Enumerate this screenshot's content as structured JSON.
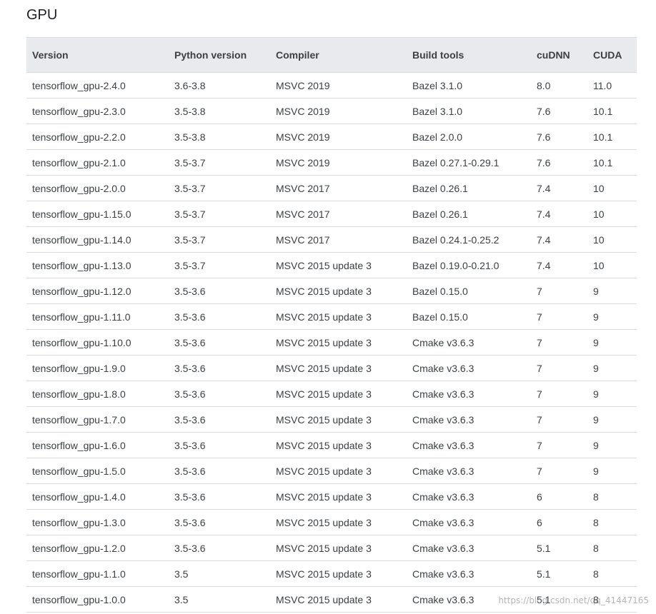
{
  "heading": "GPU",
  "table": {
    "headers": [
      "Version",
      "Python version",
      "Compiler",
      "Build tools",
      "cuDNN",
      "CUDA"
    ],
    "rows": [
      [
        "tensorflow_gpu-2.4.0",
        "3.6-3.8",
        "MSVC 2019",
        "Bazel 3.1.0",
        "8.0",
        "11.0"
      ],
      [
        "tensorflow_gpu-2.3.0",
        "3.5-3.8",
        "MSVC 2019",
        "Bazel 3.1.0",
        "7.6",
        "10.1"
      ],
      [
        "tensorflow_gpu-2.2.0",
        "3.5-3.8",
        "MSVC 2019",
        "Bazel 2.0.0",
        "7.6",
        "10.1"
      ],
      [
        "tensorflow_gpu-2.1.0",
        "3.5-3.7",
        "MSVC 2019",
        "Bazel 0.27.1-0.29.1",
        "7.6",
        "10.1"
      ],
      [
        "tensorflow_gpu-2.0.0",
        "3.5-3.7",
        "MSVC 2017",
        "Bazel 0.26.1",
        "7.4",
        "10"
      ],
      [
        "tensorflow_gpu-1.15.0",
        "3.5-3.7",
        "MSVC 2017",
        "Bazel 0.26.1",
        "7.4",
        "10"
      ],
      [
        "tensorflow_gpu-1.14.0",
        "3.5-3.7",
        "MSVC 2017",
        "Bazel 0.24.1-0.25.2",
        "7.4",
        "10"
      ],
      [
        "tensorflow_gpu-1.13.0",
        "3.5-3.7",
        "MSVC 2015 update 3",
        "Bazel 0.19.0-0.21.0",
        "7.4",
        "10"
      ],
      [
        "tensorflow_gpu-1.12.0",
        "3.5-3.6",
        "MSVC 2015 update 3",
        "Bazel 0.15.0",
        "7",
        "9"
      ],
      [
        "tensorflow_gpu-1.11.0",
        "3.5-3.6",
        "MSVC 2015 update 3",
        "Bazel 0.15.0",
        "7",
        "9"
      ],
      [
        "tensorflow_gpu-1.10.0",
        "3.5-3.6",
        "MSVC 2015 update 3",
        "Cmake v3.6.3",
        "7",
        "9"
      ],
      [
        "tensorflow_gpu-1.9.0",
        "3.5-3.6",
        "MSVC 2015 update 3",
        "Cmake v3.6.3",
        "7",
        "9"
      ],
      [
        "tensorflow_gpu-1.8.0",
        "3.5-3.6",
        "MSVC 2015 update 3",
        "Cmake v3.6.3",
        "7",
        "9"
      ],
      [
        "tensorflow_gpu-1.7.0",
        "3.5-3.6",
        "MSVC 2015 update 3",
        "Cmake v3.6.3",
        "7",
        "9"
      ],
      [
        "tensorflow_gpu-1.6.0",
        "3.5-3.6",
        "MSVC 2015 update 3",
        "Cmake v3.6.3",
        "7",
        "9"
      ],
      [
        "tensorflow_gpu-1.5.0",
        "3.5-3.6",
        "MSVC 2015 update 3",
        "Cmake v3.6.3",
        "7",
        "9"
      ],
      [
        "tensorflow_gpu-1.4.0",
        "3.5-3.6",
        "MSVC 2015 update 3",
        "Cmake v3.6.3",
        "6",
        "8"
      ],
      [
        "tensorflow_gpu-1.3.0",
        "3.5-3.6",
        "MSVC 2015 update 3",
        "Cmake v3.6.3",
        "6",
        "8"
      ],
      [
        "tensorflow_gpu-1.2.0",
        "3.5-3.6",
        "MSVC 2015 update 3",
        "Cmake v3.6.3",
        "5.1",
        "8"
      ],
      [
        "tensorflow_gpu-1.1.0",
        "3.5",
        "MSVC 2015 update 3",
        "Cmake v3.6.3",
        "5.1",
        "8"
      ],
      [
        "tensorflow_gpu-1.0.0",
        "3.5",
        "MSVC 2015 update 3",
        "Cmake v3.6.3",
        "5.1",
        "8"
      ]
    ]
  },
  "watermark": "https://blog.csdn.net/qq_41447165"
}
